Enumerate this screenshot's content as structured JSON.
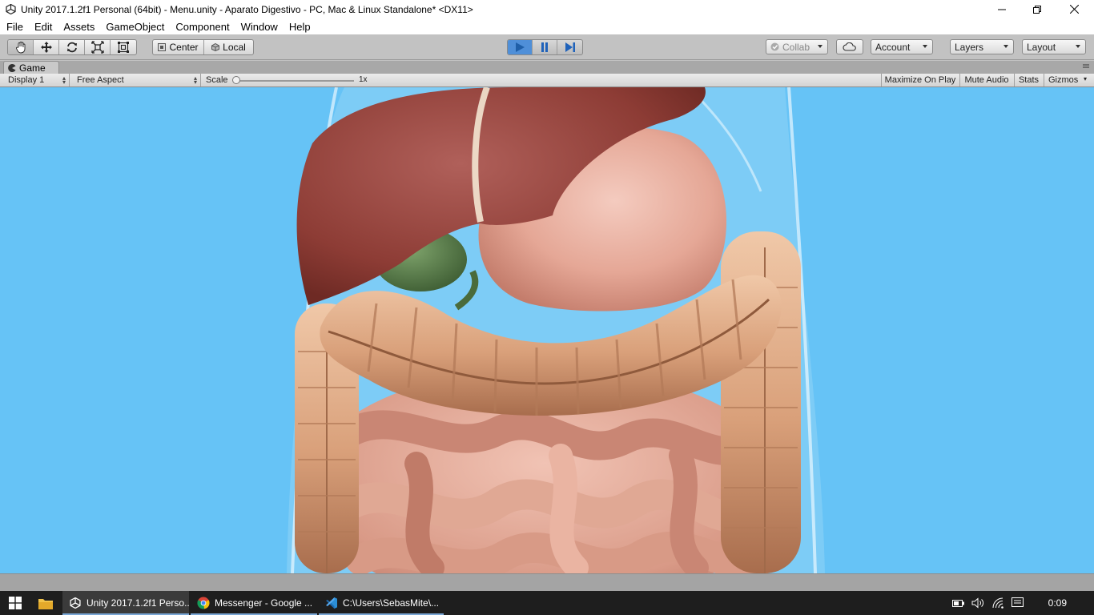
{
  "window": {
    "title": "Unity 2017.1.2f1 Personal (64bit) - Menu.unity - Aparato Digestivo - PC, Mac & Linux Standalone* <DX11>",
    "minimize_icon": "minimize-icon",
    "maximize_icon": "restore-icon",
    "close_icon": "close-icon"
  },
  "menu": {
    "items": [
      "File",
      "Edit",
      "Assets",
      "GameObject",
      "Component",
      "Window",
      "Help"
    ]
  },
  "toolbar": {
    "tools": [
      "hand-tool-icon",
      "move-tool-icon",
      "rotate-tool-icon",
      "scale-tool-icon",
      "rect-tool-icon"
    ],
    "pivot_label": "Center",
    "space_label": "Local",
    "play_icon": "play-icon",
    "pause_icon": "pause-icon",
    "step_icon": "step-icon",
    "collab_label": "Collab",
    "cloud_icon": "cloud-icon",
    "account_label": "Account",
    "layers_label": "Layers",
    "layout_label": "Layout",
    "play_state": "playing"
  },
  "game_panel": {
    "tab_label": "Game",
    "display_label": "Display 1",
    "aspect_label": "Free Aspect",
    "scale_label": "Scale",
    "scale_value": "1x",
    "maximize_label": "Maximize On Play",
    "mute_label": "Mute Audio",
    "stats_label": "Stats",
    "gizmos_label": "Gizmos",
    "background_color": "#66c3f6"
  },
  "taskbar": {
    "tasks": [
      {
        "label": "Unity 2017.1.2f1 Perso...",
        "icon": "unity-icon",
        "active": true
      },
      {
        "label": "Messenger - Google ...",
        "icon": "chrome-icon",
        "active": false
      },
      {
        "label": "C:\\Users\\SebasMite\\...",
        "icon": "vscode-icon",
        "active": false
      }
    ],
    "clock": "0:09"
  }
}
